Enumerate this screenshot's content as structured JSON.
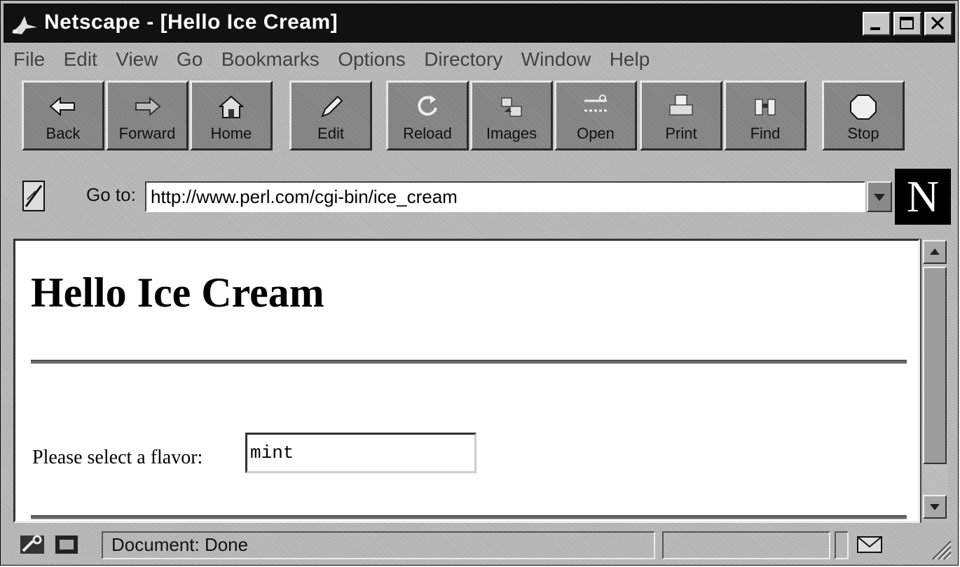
{
  "window": {
    "title": "Netscape - [Hello Ice Cream]"
  },
  "menu": [
    "File",
    "Edit",
    "View",
    "Go",
    "Bookmarks",
    "Options",
    "Directory",
    "Window",
    "Help"
  ],
  "toolbar": {
    "back": "Back",
    "forward": "Forward",
    "home": "Home",
    "edit": "Edit",
    "reload": "Reload",
    "images": "Images",
    "open": "Open",
    "print": "Print",
    "find": "Find",
    "stop": "Stop"
  },
  "location": {
    "label": "Go to:",
    "url": "http://www.perl.com/cgi-bin/ice_cream"
  },
  "logo": "N",
  "page": {
    "heading": "Hello Ice Cream",
    "flavor_label": "Please select a flavor:",
    "flavor_value": "mint"
  },
  "status": {
    "text": "Document: Done"
  },
  "icons": {
    "app": "netscape-logo-icon",
    "bookmark": "bookmark-page-icon",
    "key": "security-key-icon",
    "mail": "mail-envelope-icon"
  }
}
